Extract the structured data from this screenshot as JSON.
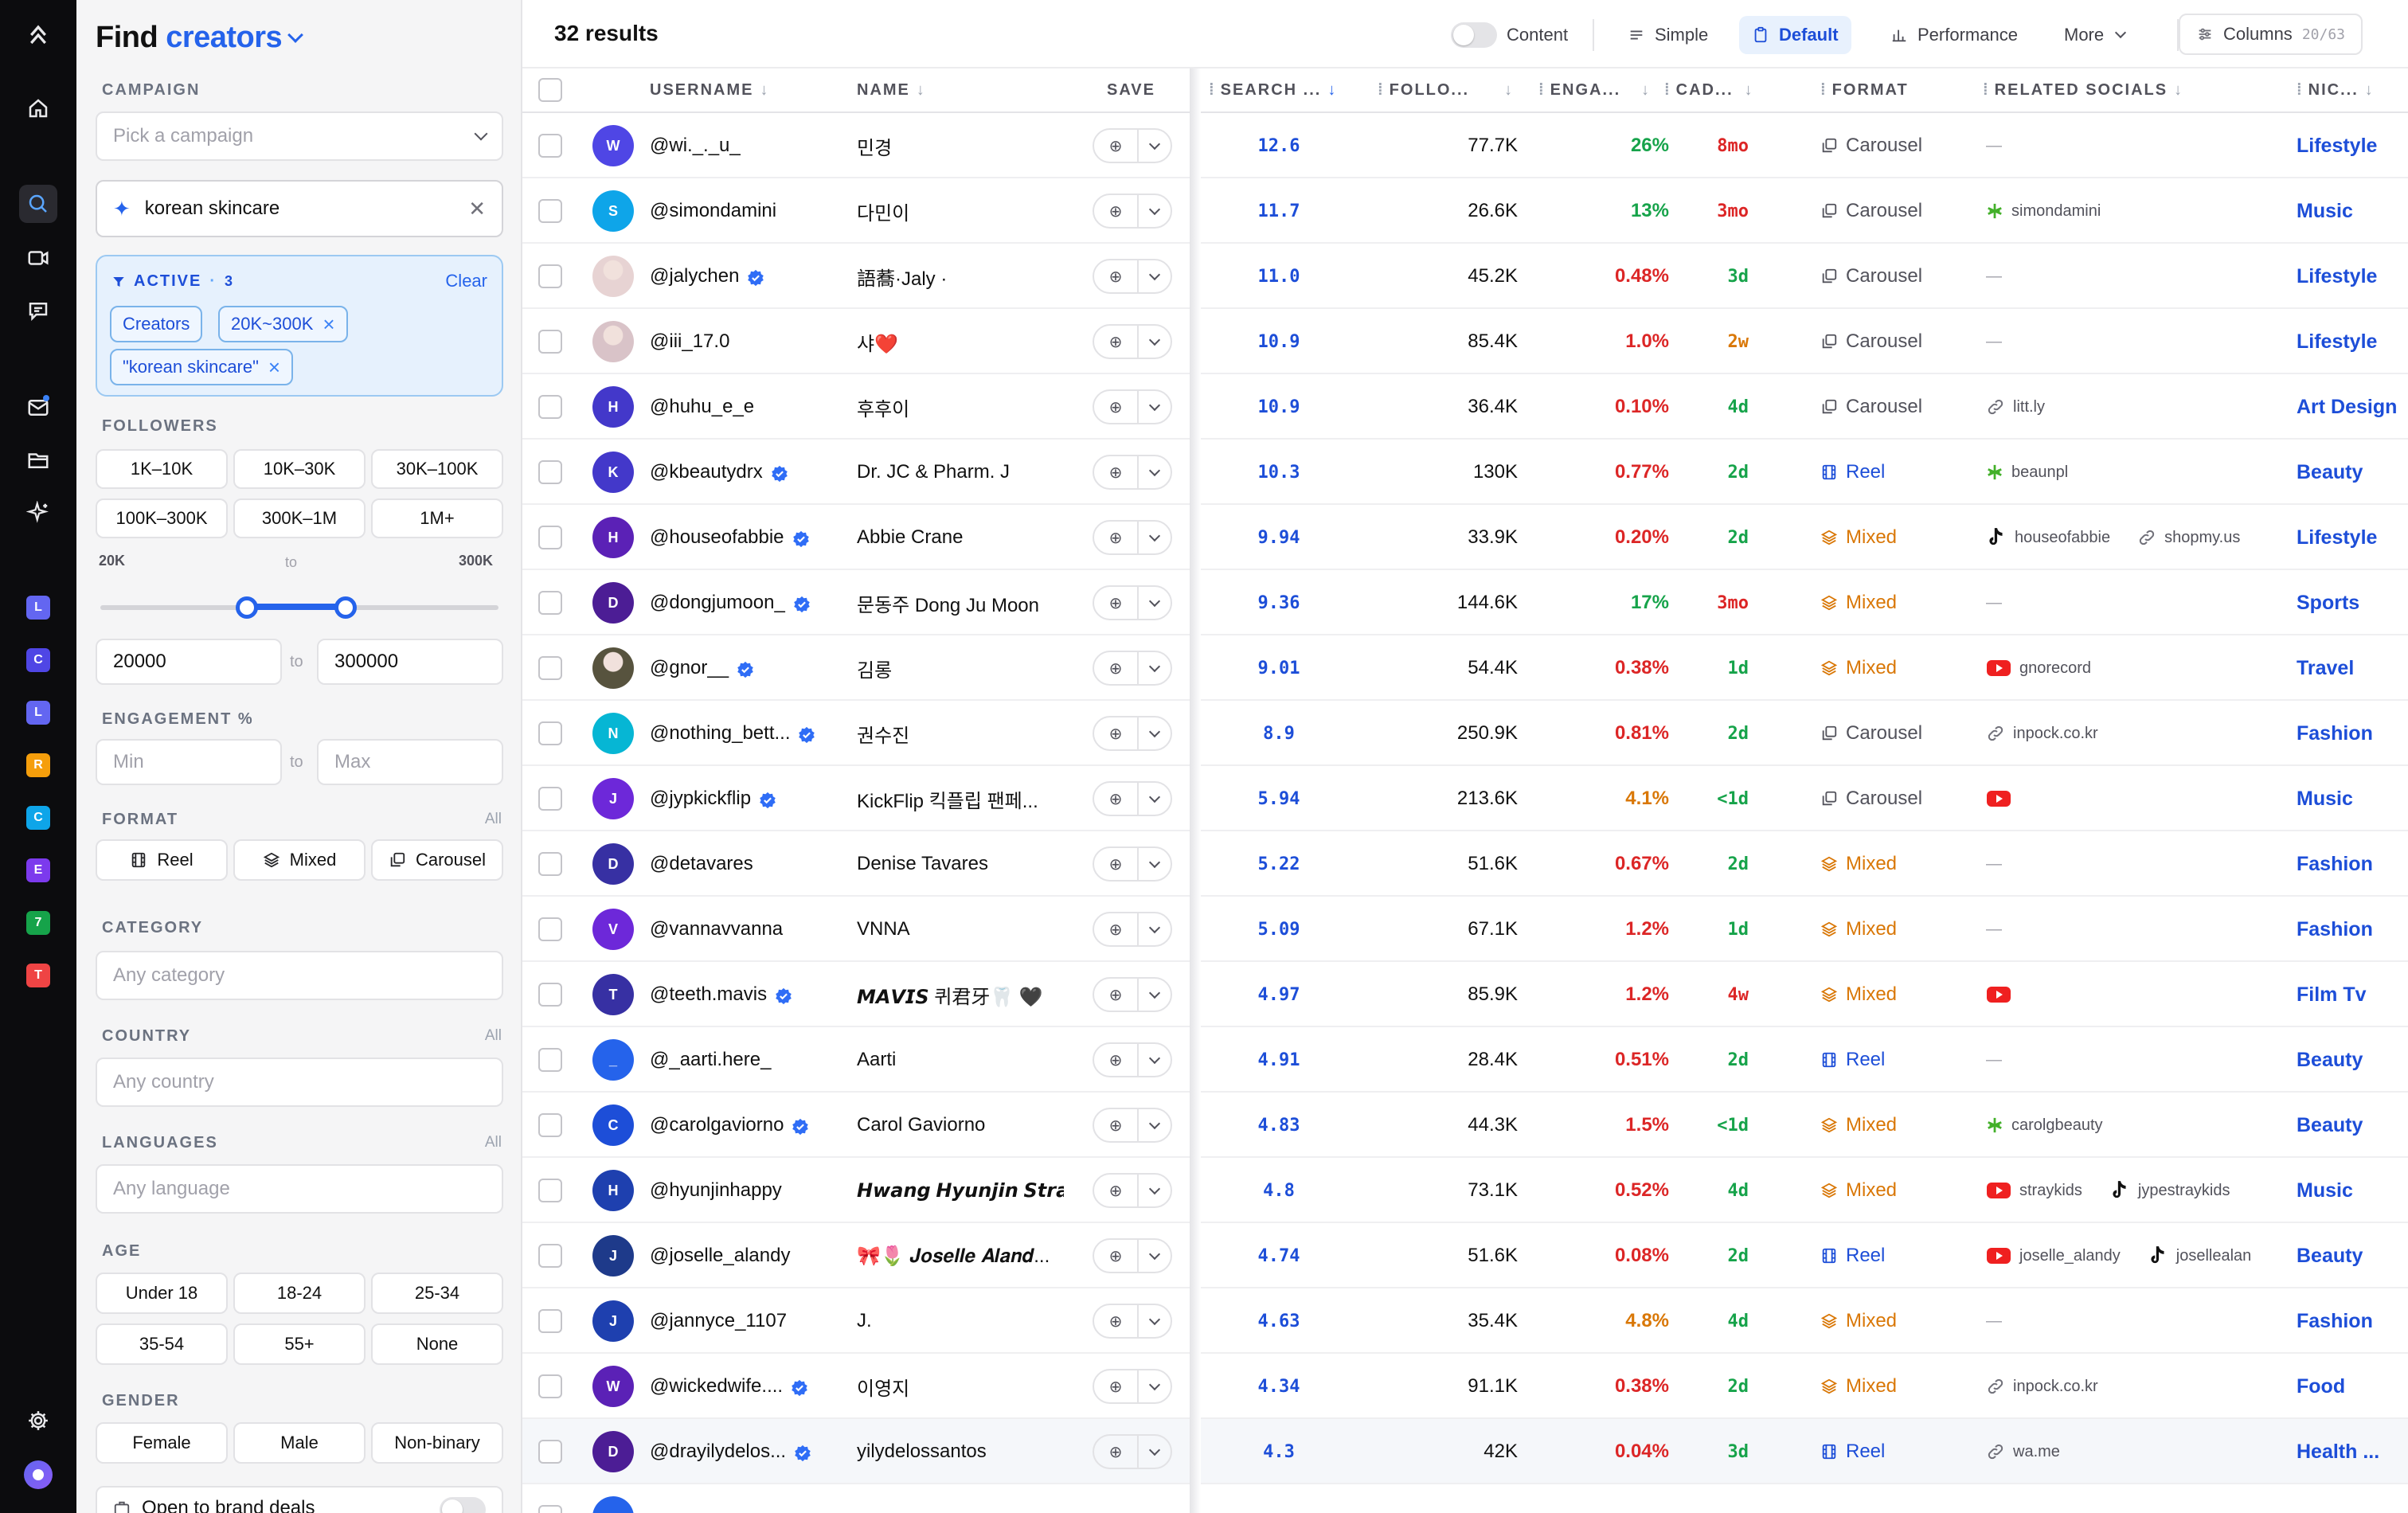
{
  "sidebar": {
    "title_prefix": "Find",
    "title_accent": "creators",
    "campaign_label": "CAMPAIGN",
    "campaign_placeholder": "Pick a campaign",
    "search_value": "korean skincare",
    "active_label": "ACTIVE",
    "active_count": "3",
    "active_sep": "·",
    "clear_label": "Clear",
    "active_chips": [
      "Creators",
      "20K~300K",
      "\"korean skincare\""
    ],
    "followers_label": "FOLLOWERS",
    "follower_buckets": [
      "1K–10K",
      "10K–30K",
      "30K–100K",
      "100K–300K",
      "300K–1M",
      "1M+"
    ],
    "range_min_label": "20K",
    "range_to": "to",
    "range_max_label": "300K",
    "range_min_fraction": 0.4,
    "range_max_fraction": 0.55,
    "min_value": "20000",
    "max_value": "300000",
    "engagement_label": "ENGAGEMENT %",
    "engagement_min_placeholder": "Min",
    "engagement_max_placeholder": "Max",
    "format_label": "FORMAT",
    "format_all": "All",
    "format_options": [
      "Reel",
      "Mixed",
      "Carousel"
    ],
    "category_label": "CATEGORY",
    "category_placeholder": "Any category",
    "country_label": "COUNTRY",
    "country_all": "All",
    "country_placeholder": "Any country",
    "languages_label": "LANGUAGES",
    "languages_all": "All",
    "languages_placeholder": "Any language",
    "age_label": "AGE",
    "age_options": [
      "Under 18",
      "18-24",
      "25-34",
      "35-54",
      "55+",
      "None"
    ],
    "gender_label": "GENDER",
    "gender_options": [
      "Female",
      "Male",
      "Non-binary"
    ],
    "brand_deals_label": "Open to brand deals"
  },
  "rail": {
    "workspaces": [
      {
        "letter": "L",
        "color": "#6366f1"
      },
      {
        "letter": "C",
        "color": "#4f46e5"
      },
      {
        "letter": "L",
        "color": "#6366f1"
      },
      {
        "letter": "R",
        "color": "#f59e0b"
      },
      {
        "letter": "C",
        "color": "#0ea5e9"
      },
      {
        "letter": "E",
        "color": "#7c3aed"
      },
      {
        "letter": "7",
        "color": "#16a34a"
      },
      {
        "letter": "T",
        "color": "#ef4444"
      }
    ]
  },
  "toolbar": {
    "results": "32 results",
    "content_label": "Content",
    "simple_label": "Simple",
    "default_label": "Default",
    "performance_label": "Performance",
    "more_label": "More",
    "columns_label": "Columns",
    "columns_count": "20/63"
  },
  "table": {
    "headers": {
      "username": "USERNAME",
      "name": "NAME",
      "save": "SAVE",
      "search": "SEARCH ...",
      "followers": "FOLLO...",
      "engagement": "ENGA...",
      "cadence": "CAD...",
      "format": "FORMAT",
      "related": "RELATED SOCIALS",
      "niche": "NIC..."
    },
    "rows": [
      {
        "initial": "W",
        "avatar": "#4f46e5",
        "username": "@wi._._u_",
        "verified": false,
        "name": "민경",
        "score": "12.6",
        "followers": "77.7K",
        "eng": "26%",
        "eng_color": "#16a34a",
        "cad": "8mo",
        "cad_color": "#dc2626",
        "format": "Carousel",
        "socials": [],
        "niche": "Lifestyle"
      },
      {
        "initial": "S",
        "avatar": "#0ea5e9",
        "username": "@simondamini",
        "verified": false,
        "name": "다민이",
        "score": "11.7",
        "followers": "26.6K",
        "eng": "13%",
        "eng_color": "#16a34a",
        "cad": "3mo",
        "cad_color": "#dc2626",
        "format": "Carousel",
        "socials": [
          {
            "type": "linktree",
            "text": "simondamini"
          }
        ],
        "niche": "Music"
      },
      {
        "initial": "J",
        "avatar": "#e7d3d3",
        "photo": true,
        "username": "@jalychen",
        "verified": true,
        "name": "語蕎·Jaly ·",
        "score": "11.0",
        "followers": "45.2K",
        "eng": "0.48%",
        "eng_color": "#dc2626",
        "cad": "3d",
        "cad_color": "#16a34a",
        "format": "Carousel",
        "socials": [],
        "niche": "Lifestyle"
      },
      {
        "initial": "I",
        "avatar": "#d9c3c8",
        "photo": true,
        "username": "@iii_17.0",
        "verified": false,
        "name": "샤❤️",
        "score": "10.9",
        "followers": "85.4K",
        "eng": "1.0%",
        "eng_color": "#dc2626",
        "cad": "2w",
        "cad_color": "#d97706",
        "format": "Carousel",
        "socials": [],
        "niche": "Lifestyle"
      },
      {
        "initial": "H",
        "avatar": "#4338ca",
        "username": "@huhu_e_e",
        "verified": false,
        "name": "후후이",
        "score": "10.9",
        "followers": "36.4K",
        "eng": "0.10%",
        "eng_color": "#dc2626",
        "cad": "4d",
        "cad_color": "#16a34a",
        "format": "Carousel",
        "socials": [
          {
            "type": "link",
            "text": "litt.ly"
          }
        ],
        "niche": "Art Design"
      },
      {
        "initial": "K",
        "avatar": "#4338ca",
        "username": "@kbeautydrx",
        "verified": true,
        "name": "Dr. JC & Pharm. J",
        "score": "10.3",
        "followers": "130K",
        "eng": "0.77%",
        "eng_color": "#dc2626",
        "cad": "2d",
        "cad_color": "#16a34a",
        "format": "Reel",
        "socials": [
          {
            "type": "linktree",
            "text": "beaunpl"
          }
        ],
        "niche": "Beauty"
      },
      {
        "initial": "H",
        "avatar": "#5b21b6",
        "username": "@houseofabbie",
        "verified": true,
        "name": "Abbie Crane",
        "score": "9.94",
        "followers": "33.9K",
        "eng": "0.20%",
        "eng_color": "#dc2626",
        "cad": "2d",
        "cad_color": "#16a34a",
        "format": "Mixed",
        "socials": [
          {
            "type": "tiktok",
            "text": "houseofabbie"
          },
          {
            "type": "link",
            "text": "shopmy.us"
          }
        ],
        "niche": "Lifestyle"
      },
      {
        "initial": "D",
        "avatar": "#4c1d95",
        "username": "@dongjumoon_",
        "verified": true,
        "name": "문동주 Dong Ju Moon",
        "score": "9.36",
        "followers": "144.6K",
        "eng": "17%",
        "eng_color": "#16a34a",
        "cad": "3mo",
        "cad_color": "#dc2626",
        "format": "Mixed",
        "socials": [],
        "niche": "Sports"
      },
      {
        "initial": "G",
        "avatar": "#57533e",
        "photo": true,
        "username": "@gnor__",
        "verified": true,
        "name": "김롱",
        "score": "9.01",
        "followers": "54.4K",
        "eng": "0.38%",
        "eng_color": "#dc2626",
        "cad": "1d",
        "cad_color": "#16a34a",
        "format": "Mixed",
        "socials": [
          {
            "type": "youtube",
            "text": "gnorecord"
          }
        ],
        "niche": "Travel"
      },
      {
        "initial": "N",
        "avatar": "#06b6d4",
        "username": "@nothing_bett...",
        "verified": true,
        "name": "권수진",
        "score": "8.9",
        "followers": "250.9K",
        "eng": "0.81%",
        "eng_color": "#dc2626",
        "cad": "2d",
        "cad_color": "#16a34a",
        "format": "Carousel",
        "socials": [
          {
            "type": "link",
            "text": "inpock.co.kr"
          }
        ],
        "niche": "Fashion"
      },
      {
        "initial": "J",
        "avatar": "#6d28d9",
        "username": "@jypkickflip",
        "verified": true,
        "name": "KickFlip 킥플립 팬페...",
        "score": "5.94",
        "followers": "213.6K",
        "eng": "4.1%",
        "eng_color": "#d97706",
        "cad": "<1d",
        "cad_color": "#16a34a",
        "format": "Carousel",
        "socials": [
          {
            "type": "youtube",
            "text": ""
          }
        ],
        "niche": "Music"
      },
      {
        "initial": "D",
        "avatar": "#3730a3",
        "username": "@detavares",
        "verified": false,
        "name": "Denise Tavares",
        "score": "5.22",
        "followers": "51.6K",
        "eng": "0.67%",
        "eng_color": "#dc2626",
        "cad": "2d",
        "cad_color": "#16a34a",
        "format": "Mixed",
        "socials": [],
        "niche": "Fashion"
      },
      {
        "initial": "V",
        "avatar": "#6d28d9",
        "username": "@vannavvanna",
        "verified": false,
        "name": "VNNA",
        "score": "5.09",
        "followers": "67.1K",
        "eng": "1.2%",
        "eng_color": "#dc2626",
        "cad": "1d",
        "cad_color": "#16a34a",
        "format": "Mixed",
        "socials": [],
        "niche": "Fashion"
      },
      {
        "initial": "T",
        "avatar": "#3730a3",
        "username": "@teeth.mavis",
        "verified": true,
        "name": "𝙈𝘼𝙑𝙄𝙎 퀴君牙🦷 🖤",
        "score": "4.97",
        "followers": "85.9K",
        "eng": "1.2%",
        "eng_color": "#dc2626",
        "cad": "4w",
        "cad_color": "#dc2626",
        "format": "Mixed",
        "socials": [
          {
            "type": "youtube",
            "text": ""
          }
        ],
        "niche": "Film Tv"
      },
      {
        "initial": "_",
        "avatar": "#2563eb",
        "username": "@_aarti.here_",
        "verified": false,
        "name": "Aarti",
        "score": "4.91",
        "followers": "28.4K",
        "eng": "0.51%",
        "eng_color": "#dc2626",
        "cad": "2d",
        "cad_color": "#16a34a",
        "format": "Reel",
        "socials": [],
        "niche": "Beauty"
      },
      {
        "initial": "C",
        "avatar": "#1d4ed8",
        "username": "@carolgaviorno",
        "verified": true,
        "name": "Carol Gaviorno",
        "score": "4.83",
        "followers": "44.3K",
        "eng": "1.5%",
        "eng_color": "#dc2626",
        "cad": "<1d",
        "cad_color": "#16a34a",
        "format": "Mixed",
        "socials": [
          {
            "type": "linktree",
            "text": "carolgbeauty"
          }
        ],
        "niche": "Beauty"
      },
      {
        "initial": "H",
        "avatar": "#1e40af",
        "username": "@hyunjinhappy",
        "verified": false,
        "name": "𝙃𝙬𝙖𝙣𝙜 𝙃𝙮𝙪𝙣𝙟𝙞𝙣 𝙎𝙩𝙧𝙖𝙮...",
        "score": "4.8",
        "followers": "73.1K",
        "eng": "0.52%",
        "eng_color": "#dc2626",
        "cad": "4d",
        "cad_color": "#16a34a",
        "format": "Mixed",
        "socials": [
          {
            "type": "youtube",
            "text": "straykids"
          },
          {
            "type": "tiktok",
            "text": "jypestraykids"
          }
        ],
        "niche": "Music"
      },
      {
        "initial": "J",
        "avatar": "#1e3a8a",
        "username": "@joselle_alandy",
        "verified": false,
        "name": "🎀🌷 𝑱𝒐𝒔𝒆𝒍𝒍𝒆 𝑨𝒍𝒂𝒏𝒅...",
        "score": "4.74",
        "followers": "51.6K",
        "eng": "0.08%",
        "eng_color": "#dc2626",
        "cad": "2d",
        "cad_color": "#16a34a",
        "format": "Reel",
        "socials": [
          {
            "type": "youtube",
            "text": "joselle_alandy"
          },
          {
            "type": "tiktok",
            "text": "josellealan"
          }
        ],
        "niche": "Beauty"
      },
      {
        "initial": "J",
        "avatar": "#1e40af",
        "username": "@jannyce_1107",
        "verified": false,
        "name": "J.",
        "score": "4.63",
        "followers": "35.4K",
        "eng": "4.8%",
        "eng_color": "#d97706",
        "cad": "4d",
        "cad_color": "#16a34a",
        "format": "Mixed",
        "socials": [],
        "niche": "Fashion"
      },
      {
        "initial": "W",
        "avatar": "#5b21b6",
        "username": "@wickedwife....",
        "verified": true,
        "name": "이영지",
        "score": "4.34",
        "followers": "91.1K",
        "eng": "0.38%",
        "eng_color": "#dc2626",
        "cad": "2d",
        "cad_color": "#16a34a",
        "format": "Mixed",
        "socials": [
          {
            "type": "link",
            "text": "inpock.co.kr"
          }
        ],
        "niche": "Food"
      },
      {
        "initial": "D",
        "avatar": "#4c1d95",
        "username": "@drayilydelos...",
        "verified": true,
        "name": "yilydelossantos",
        "score": "4.3",
        "followers": "42K",
        "eng": "0.04%",
        "eng_color": "#dc2626",
        "cad": "3d",
        "cad_color": "#16a34a",
        "format": "Reel",
        "socials": [
          {
            "type": "link",
            "text": "wa.me"
          }
        ],
        "niche": "Health ...",
        "highlight": true
      }
    ]
  }
}
